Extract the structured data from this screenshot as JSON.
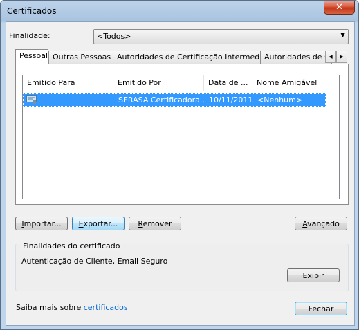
{
  "window": {
    "title": "Certificados",
    "close_label": "✕"
  },
  "purpose": {
    "label_prefix": "F",
    "label_underlined": "i",
    "label_rest": "nalidade:",
    "value": "<Todos>"
  },
  "tabs": [
    {
      "label": "Pessoal",
      "active": true
    },
    {
      "label": "Outras Pessoas",
      "active": false
    },
    {
      "label": "Autoridades de Certificação Intermediárias",
      "active": false
    },
    {
      "label": "Autoridades de Ce",
      "active": false
    }
  ],
  "tab_scroll": {
    "left": "◀",
    "right": "▶"
  },
  "table": {
    "columns": [
      "Emitido Para",
      "Emitido Por",
      "Data de ...",
      "Nome Amigável"
    ],
    "rows": [
      {
        "issued_to": "",
        "issued_by": "SERASA Certificadora...",
        "date": "10/11/2011",
        "friendly_name": "<Nenhum>",
        "selected": true
      }
    ]
  },
  "buttons": {
    "import": {
      "u": "I",
      "rest": "mportar..."
    },
    "export": {
      "u": "E",
      "rest": "xportar..."
    },
    "remove": {
      "u": "R",
      "rest": "emover"
    },
    "advanced": {
      "u": "A",
      "rest": "vançado"
    },
    "view": {
      "pre": "E",
      "u": "x",
      "rest": "ibir"
    },
    "close": "Fechar"
  },
  "purposes_group": {
    "title": "Finalidades do certificado",
    "text": "Autenticação de Cliente, Email Seguro"
  },
  "footer": {
    "text": "Saiba mais sobre ",
    "link": "certificados"
  },
  "colors": {
    "selection": "#3399ff",
    "link": "#0066cc",
    "close_button": "#c4361a"
  }
}
